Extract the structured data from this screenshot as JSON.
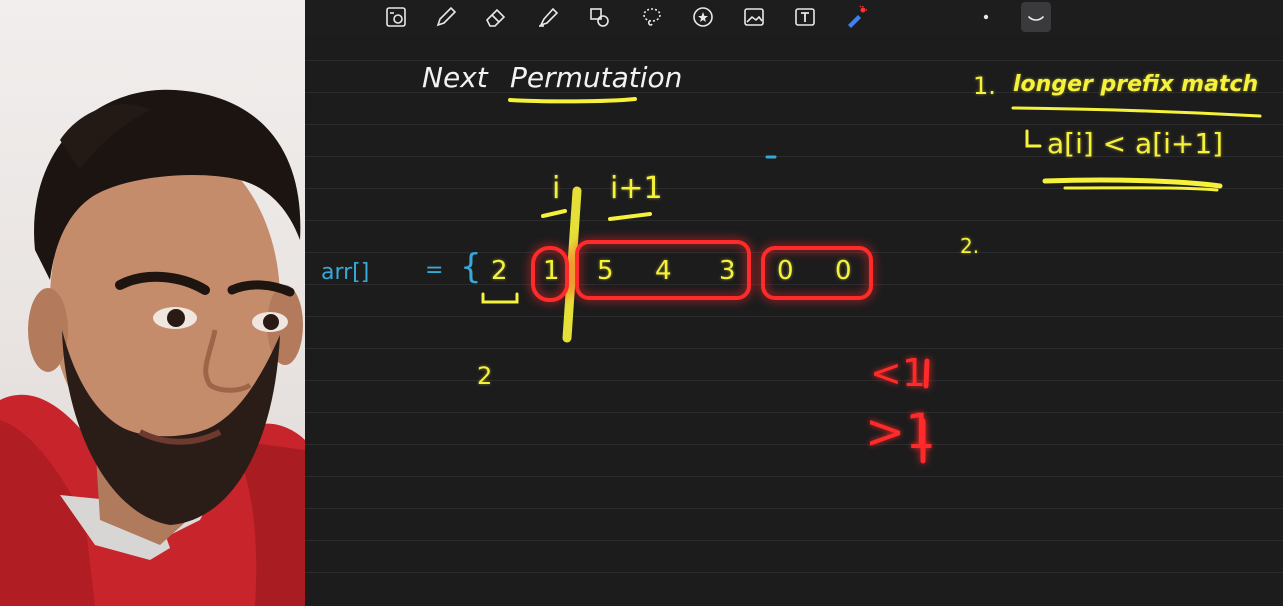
{
  "toolbar": {
    "tools": [
      {
        "name": "zoom-image-icon"
      },
      {
        "name": "pen-icon"
      },
      {
        "name": "eraser-icon"
      },
      {
        "name": "highlighter-icon"
      },
      {
        "name": "shapes-icon"
      },
      {
        "name": "lasso-icon"
      },
      {
        "name": "sticker-icon"
      },
      {
        "name": "image-icon"
      },
      {
        "name": "text-box-icon"
      },
      {
        "name": "laser-pointer-icon"
      }
    ],
    "pen_dot_icon": "small-dot-icon",
    "stroke_icon": "stroke-curve-icon",
    "accent": "#f6f13a"
  },
  "notes": {
    "title_part1": "Next",
    "title_part2": "Permutation",
    "arr_label": "arr[]",
    "equals": "=",
    "open_brace": "{",
    "val_2": "2",
    "val_1": "1",
    "val_5": "5",
    "val_4": "4",
    "val_3": "3",
    "val_0a": "0",
    "val_0b": "0",
    "idx_i": "i",
    "idx_i1": "i+1",
    "below_2": "2",
    "step1": "1.",
    "step1_text": "longer prefix match",
    "condition": "a[i] < a[i+1]",
    "step2": "2.",
    "less_one": "<1",
    "greater_one": ">1"
  },
  "colors": {
    "ink_white": "#f2f2f2",
    "ink_yellow": "#f6f13a",
    "ink_cyan": "#36a9d6",
    "ink_red": "#ff2a2a",
    "hoodie_red": "#c8242b"
  }
}
